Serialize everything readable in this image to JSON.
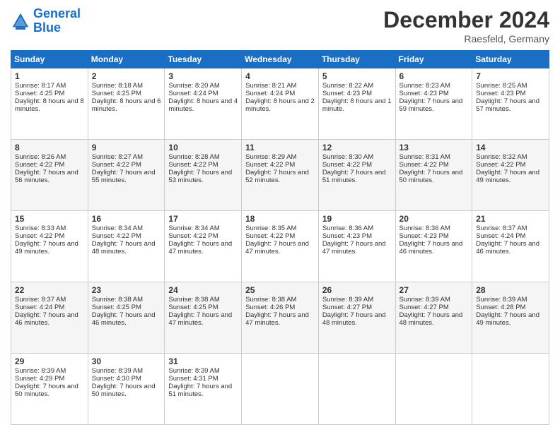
{
  "logo": {
    "line1": "General",
    "line2": "Blue"
  },
  "title": "December 2024",
  "location": "Raesfeld, Germany",
  "days_header": [
    "Sunday",
    "Monday",
    "Tuesday",
    "Wednesday",
    "Thursday",
    "Friday",
    "Saturday"
  ],
  "weeks": [
    [
      {
        "day": "1",
        "sunrise": "8:17 AM",
        "sunset": "4:25 PM",
        "daylight": "8 hours and 8 minutes."
      },
      {
        "day": "2",
        "sunrise": "8:18 AM",
        "sunset": "4:25 PM",
        "daylight": "8 hours and 6 minutes."
      },
      {
        "day": "3",
        "sunrise": "8:20 AM",
        "sunset": "4:24 PM",
        "daylight": "8 hours and 4 minutes."
      },
      {
        "day": "4",
        "sunrise": "8:21 AM",
        "sunset": "4:24 PM",
        "daylight": "8 hours and 2 minutes."
      },
      {
        "day": "5",
        "sunrise": "8:22 AM",
        "sunset": "4:23 PM",
        "daylight": "8 hours and 1 minute."
      },
      {
        "day": "6",
        "sunrise": "8:23 AM",
        "sunset": "4:23 PM",
        "daylight": "7 hours and 59 minutes."
      },
      {
        "day": "7",
        "sunrise": "8:25 AM",
        "sunset": "4:23 PM",
        "daylight": "7 hours and 57 minutes."
      }
    ],
    [
      {
        "day": "8",
        "sunrise": "8:26 AM",
        "sunset": "4:22 PM",
        "daylight": "7 hours and 56 minutes."
      },
      {
        "day": "9",
        "sunrise": "8:27 AM",
        "sunset": "4:22 PM",
        "daylight": "7 hours and 55 minutes."
      },
      {
        "day": "10",
        "sunrise": "8:28 AM",
        "sunset": "4:22 PM",
        "daylight": "7 hours and 53 minutes."
      },
      {
        "day": "11",
        "sunrise": "8:29 AM",
        "sunset": "4:22 PM",
        "daylight": "7 hours and 52 minutes."
      },
      {
        "day": "12",
        "sunrise": "8:30 AM",
        "sunset": "4:22 PM",
        "daylight": "7 hours and 51 minutes."
      },
      {
        "day": "13",
        "sunrise": "8:31 AM",
        "sunset": "4:22 PM",
        "daylight": "7 hours and 50 minutes."
      },
      {
        "day": "14",
        "sunrise": "8:32 AM",
        "sunset": "4:22 PM",
        "daylight": "7 hours and 49 minutes."
      }
    ],
    [
      {
        "day": "15",
        "sunrise": "8:33 AM",
        "sunset": "4:22 PM",
        "daylight": "7 hours and 49 minutes."
      },
      {
        "day": "16",
        "sunrise": "8:34 AM",
        "sunset": "4:22 PM",
        "daylight": "7 hours and 48 minutes."
      },
      {
        "day": "17",
        "sunrise": "8:34 AM",
        "sunset": "4:22 PM",
        "daylight": "7 hours and 47 minutes."
      },
      {
        "day": "18",
        "sunrise": "8:35 AM",
        "sunset": "4:22 PM",
        "daylight": "7 hours and 47 minutes."
      },
      {
        "day": "19",
        "sunrise": "8:36 AM",
        "sunset": "4:23 PM",
        "daylight": "7 hours and 47 minutes."
      },
      {
        "day": "20",
        "sunrise": "8:36 AM",
        "sunset": "4:23 PM",
        "daylight": "7 hours and 46 minutes."
      },
      {
        "day": "21",
        "sunrise": "8:37 AM",
        "sunset": "4:24 PM",
        "daylight": "7 hours and 46 minutes."
      }
    ],
    [
      {
        "day": "22",
        "sunrise": "8:37 AM",
        "sunset": "4:24 PM",
        "daylight": "7 hours and 46 minutes."
      },
      {
        "day": "23",
        "sunrise": "8:38 AM",
        "sunset": "4:25 PM",
        "daylight": "7 hours and 46 minutes."
      },
      {
        "day": "24",
        "sunrise": "8:38 AM",
        "sunset": "4:25 PM",
        "daylight": "7 hours and 47 minutes."
      },
      {
        "day": "25",
        "sunrise": "8:38 AM",
        "sunset": "4:26 PM",
        "daylight": "7 hours and 47 minutes."
      },
      {
        "day": "26",
        "sunrise": "8:39 AM",
        "sunset": "4:27 PM",
        "daylight": "7 hours and 48 minutes."
      },
      {
        "day": "27",
        "sunrise": "8:39 AM",
        "sunset": "4:27 PM",
        "daylight": "7 hours and 48 minutes."
      },
      {
        "day": "28",
        "sunrise": "8:39 AM",
        "sunset": "4:28 PM",
        "daylight": "7 hours and 49 minutes."
      }
    ],
    [
      {
        "day": "29",
        "sunrise": "8:39 AM",
        "sunset": "4:29 PM",
        "daylight": "7 hours and 50 minutes."
      },
      {
        "day": "30",
        "sunrise": "8:39 AM",
        "sunset": "4:30 PM",
        "daylight": "7 hours and 50 minutes."
      },
      {
        "day": "31",
        "sunrise": "8:39 AM",
        "sunset": "4:31 PM",
        "daylight": "7 hours and 51 minutes."
      },
      null,
      null,
      null,
      null
    ]
  ],
  "labels": {
    "sunrise": "Sunrise:",
    "sunset": "Sunset:",
    "daylight": "Daylight:"
  }
}
